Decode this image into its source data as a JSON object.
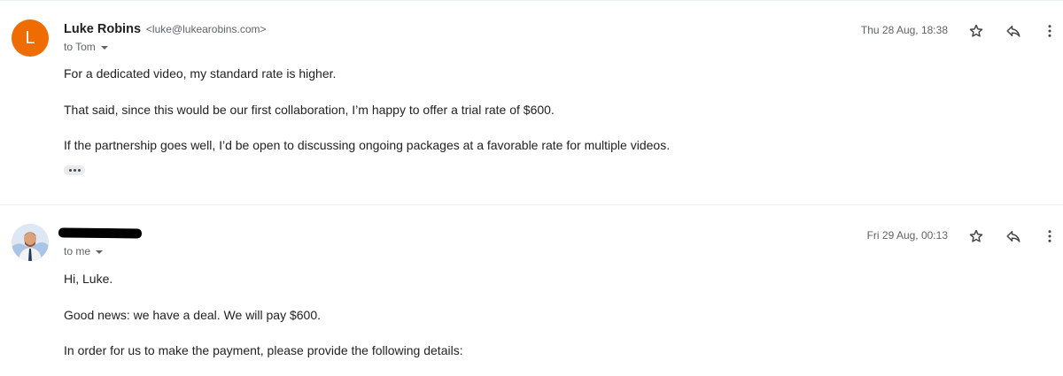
{
  "colors": {
    "avatar_orange": "#ef6c00",
    "meta_gray": "#5f6368",
    "icon_gray": "#444746",
    "divider": "#eceff1"
  },
  "messages": [
    {
      "avatar_letter": "L",
      "sender_name": "Luke Robins",
      "sender_email": "<luke@lukearobins.com>",
      "to": "to Tom",
      "date": "Thu 28 Aug, 18:38",
      "body": [
        "For a dedicated video, my standard rate is higher.",
        "That said, since this would be our first collaboration, I’m happy to offer a trial rate of $600.",
        "If the partnership goes well, I’d be open to discussing ongoing packages at a favorable rate for multiple videos."
      ],
      "icons": [
        "star-icon",
        "reply-icon",
        "more-vert-icon",
        "show-trimmed-content-icon"
      ]
    },
    {
      "sender_redacted": true,
      "to": "to me",
      "date": "Fri 29 Aug, 00:13",
      "body": [
        "Hi, Luke.",
        "Good news: we have a deal. We will pay $600.",
        "In order for us to make the payment, please provide the following details:"
      ],
      "icons": [
        "profile-photo-avatar",
        "star-icon",
        "reply-icon",
        "more-vert-icon"
      ]
    }
  ]
}
